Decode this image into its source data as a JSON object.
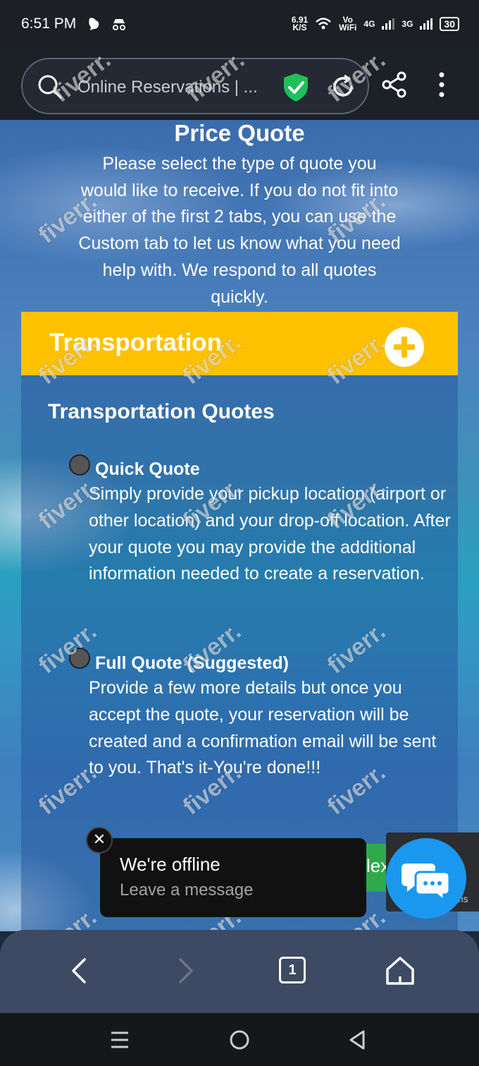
{
  "status_bar": {
    "time": "6:51 PM",
    "speed_value": "6.91",
    "speed_unit": "K/S",
    "volte": "Vo",
    "wifi_label": "WiFi",
    "net1": "4G",
    "net2": "3G",
    "battery": "30"
  },
  "browser": {
    "url_title": "Online Reservations | ...",
    "icons": [
      "search-icon",
      "shield-check-icon",
      "reload-icon",
      "share-icon",
      "more-vertical-icon"
    ]
  },
  "page": {
    "title": "Price Quote",
    "description": "Please select the type of quote you would like to receive. If you do not fit into either of the first 2 tabs, you can use the Custom tab to let us know what you need help with. We respond to all quotes quickly.",
    "accordion": {
      "title": "Transportation",
      "panel_heading": "Transportation Quotes",
      "options": [
        {
          "title": "Quick Quote",
          "description": "Simply provide your pickup location (airport or other location) and your drop-off location. After your quote you may provide the additional information needed to create a reservation.",
          "selected": false
        },
        {
          "title": "Full Quote (Suggested)",
          "description": "Provide a few more details but once you accept the quote, your reservation will be created and a confirmation email will be sent to you. That's it-You're done!!!",
          "selected": false
        }
      ]
    },
    "next_button_partial": "lex",
    "recaptcha_partial": "ms"
  },
  "chat": {
    "status": "We're offline",
    "cta": "Leave a message",
    "close": "✕"
  },
  "bottom_nav": {
    "tab_count": "1"
  },
  "watermark": "fiverr.",
  "colors": {
    "accordion": "#fec101",
    "chat_fab": "#1a98f0",
    "shield": "#1fbf5a"
  }
}
